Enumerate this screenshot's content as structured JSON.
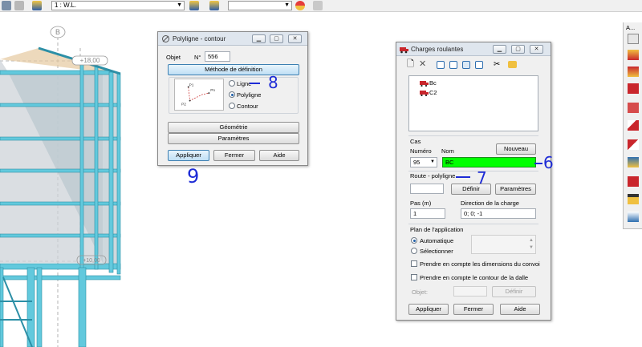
{
  "toolbar": {
    "case_select": "1 : W.L."
  },
  "canvas": {
    "axis_label": "B",
    "level_top": "+18,00",
    "level_bottom": "+10,00"
  },
  "polyligne": {
    "title": "Polyligne - contour",
    "objet_label": "Objet",
    "numero_label": "N°",
    "numero_value": "556",
    "methode_button": "Méthode de définition",
    "sketch_labels": {
      "p1": "P1",
      "p2": "P2",
      "pn": "Pn"
    },
    "options": [
      "Ligne",
      "Polyligne",
      "Contour"
    ],
    "selected_option": "Polyligne",
    "geometrie_button": "Géométrie",
    "parametres_button": "Paramètres",
    "appliquer_button": "Appliquer",
    "fermer_button": "Fermer",
    "aide_button": "Aide"
  },
  "charges": {
    "title": "Charges roulantes",
    "convois": [
      "Bc",
      "C2"
    ],
    "cas_label": "Cas",
    "numero_label": "Numéro",
    "nom_label": "Nom",
    "nouveau_button": "Nouveau",
    "numero_value": "95",
    "nom_value": "BC",
    "route_label": "Route - polyligne",
    "definir_button": "Définir",
    "parametres_button": "Paramètres",
    "pas_label": "Pas (m)",
    "pas_value": "1",
    "direction_label": "Direction de la charge",
    "direction_value": "0; 0; -1",
    "plan_label": "Plan de l'application",
    "plan_options": [
      "Automatique",
      "Sélectionner"
    ],
    "plan_selected": "Automatique",
    "check_dimensions": "Prendre en compte les dimensions du convoi",
    "check_contour": "Prendre en compte le contour de la dalle",
    "objet_label": "Objet:",
    "objet_definir_button": "Définir",
    "appliquer_button": "Appliquer",
    "fermer_button": "Fermer",
    "aide_button": "Aide"
  },
  "right_panel": {
    "title": "A..."
  },
  "annotations": {
    "ligne_mark": "8",
    "appliquer_mark": "9",
    "definir_mark": "7",
    "nom_mark": "6"
  },
  "colors": {
    "structure": "#62c9dd",
    "highlight_field": "#00ff00",
    "annotation_ink": "#1d2bd6"
  }
}
